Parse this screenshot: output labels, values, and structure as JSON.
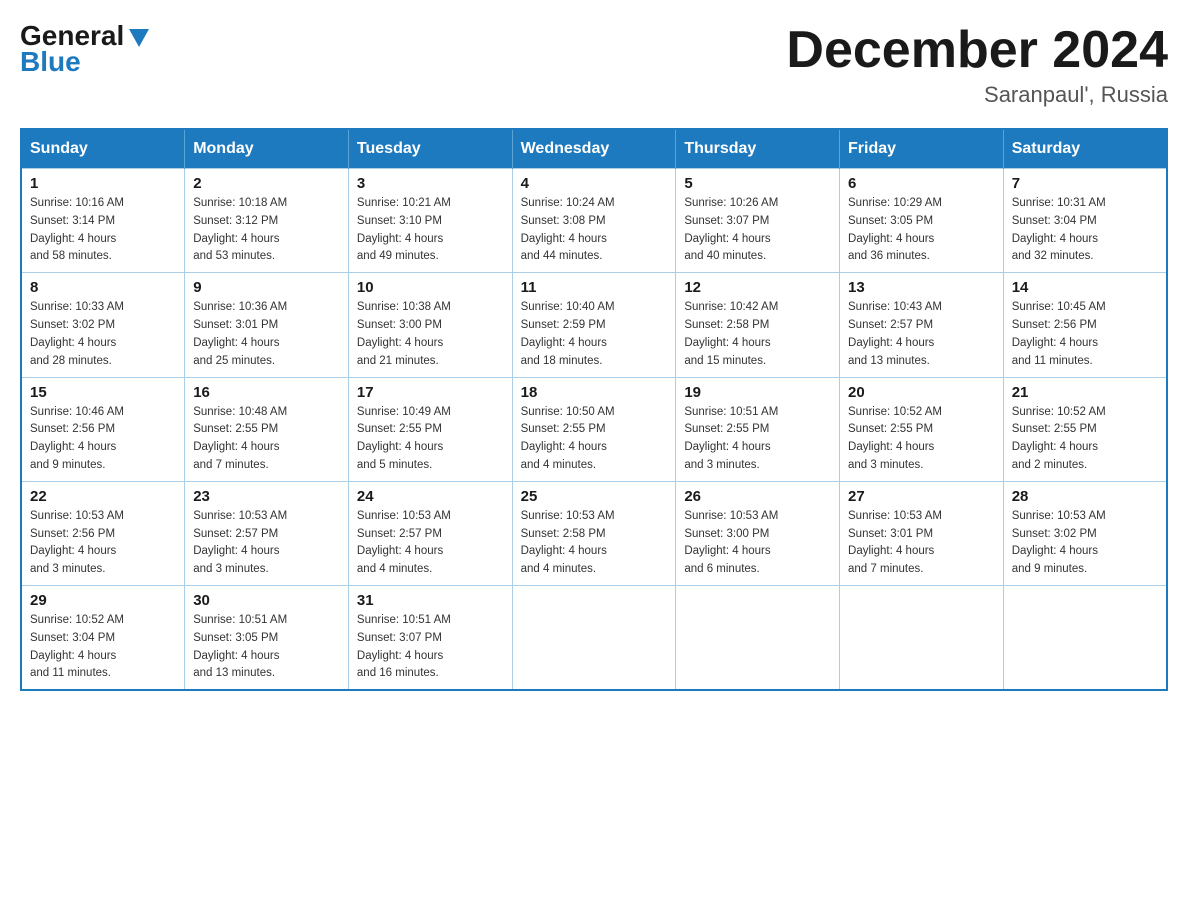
{
  "header": {
    "logo_general": "General",
    "logo_blue": "Blue",
    "month_title": "December 2024",
    "location": "Saranpaul', Russia"
  },
  "weekdays": [
    "Sunday",
    "Monday",
    "Tuesday",
    "Wednesday",
    "Thursday",
    "Friday",
    "Saturday"
  ],
  "weeks": [
    [
      {
        "day": "1",
        "sunrise": "10:16 AM",
        "sunset": "3:14 PM",
        "daylight": "4 hours and 58 minutes."
      },
      {
        "day": "2",
        "sunrise": "10:18 AM",
        "sunset": "3:12 PM",
        "daylight": "4 hours and 53 minutes."
      },
      {
        "day": "3",
        "sunrise": "10:21 AM",
        "sunset": "3:10 PM",
        "daylight": "4 hours and 49 minutes."
      },
      {
        "day": "4",
        "sunrise": "10:24 AM",
        "sunset": "3:08 PM",
        "daylight": "4 hours and 44 minutes."
      },
      {
        "day": "5",
        "sunrise": "10:26 AM",
        "sunset": "3:07 PM",
        "daylight": "4 hours and 40 minutes."
      },
      {
        "day": "6",
        "sunrise": "10:29 AM",
        "sunset": "3:05 PM",
        "daylight": "4 hours and 36 minutes."
      },
      {
        "day": "7",
        "sunrise": "10:31 AM",
        "sunset": "3:04 PM",
        "daylight": "4 hours and 32 minutes."
      }
    ],
    [
      {
        "day": "8",
        "sunrise": "10:33 AM",
        "sunset": "3:02 PM",
        "daylight": "4 hours and 28 minutes."
      },
      {
        "day": "9",
        "sunrise": "10:36 AM",
        "sunset": "3:01 PM",
        "daylight": "4 hours and 25 minutes."
      },
      {
        "day": "10",
        "sunrise": "10:38 AM",
        "sunset": "3:00 PM",
        "daylight": "4 hours and 21 minutes."
      },
      {
        "day": "11",
        "sunrise": "10:40 AM",
        "sunset": "2:59 PM",
        "daylight": "4 hours and 18 minutes."
      },
      {
        "day": "12",
        "sunrise": "10:42 AM",
        "sunset": "2:58 PM",
        "daylight": "4 hours and 15 minutes."
      },
      {
        "day": "13",
        "sunrise": "10:43 AM",
        "sunset": "2:57 PM",
        "daylight": "4 hours and 13 minutes."
      },
      {
        "day": "14",
        "sunrise": "10:45 AM",
        "sunset": "2:56 PM",
        "daylight": "4 hours and 11 minutes."
      }
    ],
    [
      {
        "day": "15",
        "sunrise": "10:46 AM",
        "sunset": "2:56 PM",
        "daylight": "4 hours and 9 minutes."
      },
      {
        "day": "16",
        "sunrise": "10:48 AM",
        "sunset": "2:55 PM",
        "daylight": "4 hours and 7 minutes."
      },
      {
        "day": "17",
        "sunrise": "10:49 AM",
        "sunset": "2:55 PM",
        "daylight": "4 hours and 5 minutes."
      },
      {
        "day": "18",
        "sunrise": "10:50 AM",
        "sunset": "2:55 PM",
        "daylight": "4 hours and 4 minutes."
      },
      {
        "day": "19",
        "sunrise": "10:51 AM",
        "sunset": "2:55 PM",
        "daylight": "4 hours and 3 minutes."
      },
      {
        "day": "20",
        "sunrise": "10:52 AM",
        "sunset": "2:55 PM",
        "daylight": "4 hours and 3 minutes."
      },
      {
        "day": "21",
        "sunrise": "10:52 AM",
        "sunset": "2:55 PM",
        "daylight": "4 hours and 2 minutes."
      }
    ],
    [
      {
        "day": "22",
        "sunrise": "10:53 AM",
        "sunset": "2:56 PM",
        "daylight": "4 hours and 3 minutes."
      },
      {
        "day": "23",
        "sunrise": "10:53 AM",
        "sunset": "2:57 PM",
        "daylight": "4 hours and 3 minutes."
      },
      {
        "day": "24",
        "sunrise": "10:53 AM",
        "sunset": "2:57 PM",
        "daylight": "4 hours and 4 minutes."
      },
      {
        "day": "25",
        "sunrise": "10:53 AM",
        "sunset": "2:58 PM",
        "daylight": "4 hours and 4 minutes."
      },
      {
        "day": "26",
        "sunrise": "10:53 AM",
        "sunset": "3:00 PM",
        "daylight": "4 hours and 6 minutes."
      },
      {
        "day": "27",
        "sunrise": "10:53 AM",
        "sunset": "3:01 PM",
        "daylight": "4 hours and 7 minutes."
      },
      {
        "day": "28",
        "sunrise": "10:53 AM",
        "sunset": "3:02 PM",
        "daylight": "4 hours and 9 minutes."
      }
    ],
    [
      {
        "day": "29",
        "sunrise": "10:52 AM",
        "sunset": "3:04 PM",
        "daylight": "4 hours and 11 minutes."
      },
      {
        "day": "30",
        "sunrise": "10:51 AM",
        "sunset": "3:05 PM",
        "daylight": "4 hours and 13 minutes."
      },
      {
        "day": "31",
        "sunrise": "10:51 AM",
        "sunset": "3:07 PM",
        "daylight": "4 hours and 16 minutes."
      },
      null,
      null,
      null,
      null
    ]
  ],
  "labels": {
    "sunrise_prefix": "Sunrise: ",
    "sunset_prefix": "Sunset: ",
    "daylight_prefix": "Daylight: "
  }
}
